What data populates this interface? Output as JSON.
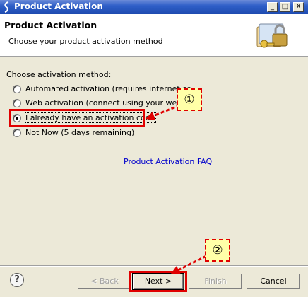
{
  "window": {
    "title": "Product Activation",
    "minimize_glyph": "_",
    "maximize_glyph": "□",
    "close_glyph": "X"
  },
  "header": {
    "title": "Product Activation",
    "description": "Choose your product activation method",
    "image_icon": "lock-key-folder-icon"
  },
  "body": {
    "group_label": "Choose activation method:",
    "options": [
      {
        "label": "Automated activation (requires internet co",
        "selected": false
      },
      {
        "label": "Web activation (connect using your web",
        "selected": false
      },
      {
        "label": "I already have an activation code",
        "selected": true
      },
      {
        "label": "Not Now (5 days remaining)",
        "selected": false
      }
    ],
    "faq_link": "Product Activation FAQ"
  },
  "footer": {
    "help_label": "?",
    "back_label": "< Back",
    "next_label": "Next >",
    "finish_label": "Finish",
    "cancel_label": "Cancel"
  },
  "annotations": {
    "callout_1": "①",
    "callout_2": "②",
    "highlight_color": "#e00000",
    "callout_fill": "#ffffa8"
  }
}
